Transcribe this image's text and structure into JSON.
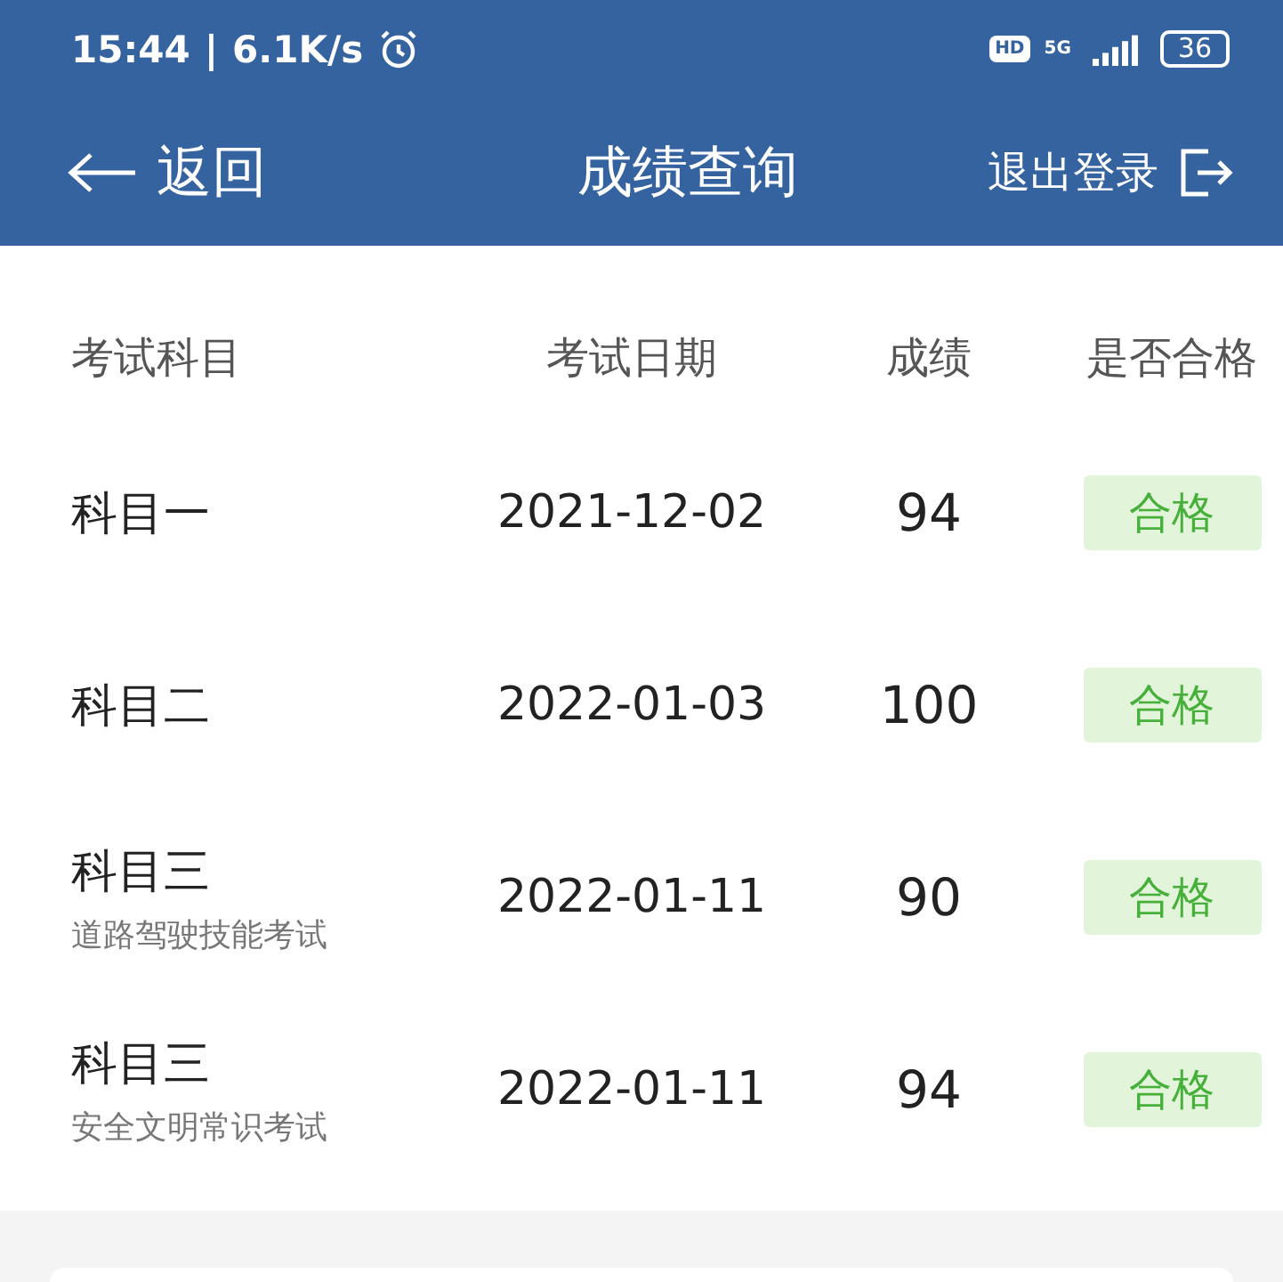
{
  "status_bar": {
    "time": "15:44",
    "separator": "|",
    "speed": "6.1K/s",
    "hd": "HD",
    "network": "5G",
    "battery": "36"
  },
  "header": {
    "back": "返回",
    "title": "成绩查询",
    "logout": "退出登录"
  },
  "table": {
    "columns": [
      "考试科目",
      "考试日期",
      "成绩",
      "是否合格"
    ],
    "rows": [
      {
        "subject": "科目一",
        "date": "2021-12-02",
        "score": "94",
        "result": "合格"
      },
      {
        "subject": "科目二",
        "date": "2022-01-03",
        "score": "100",
        "result": "合格"
      },
      {
        "subject": "科目三",
        "note": "道路驾驶技能考试",
        "date": "2022-01-11",
        "score": "90",
        "result": "合格"
      },
      {
        "subject": "科目三",
        "note": "安全文明常识考试",
        "date": "2022-01-11",
        "score": "94",
        "result": "合格"
      }
    ]
  }
}
